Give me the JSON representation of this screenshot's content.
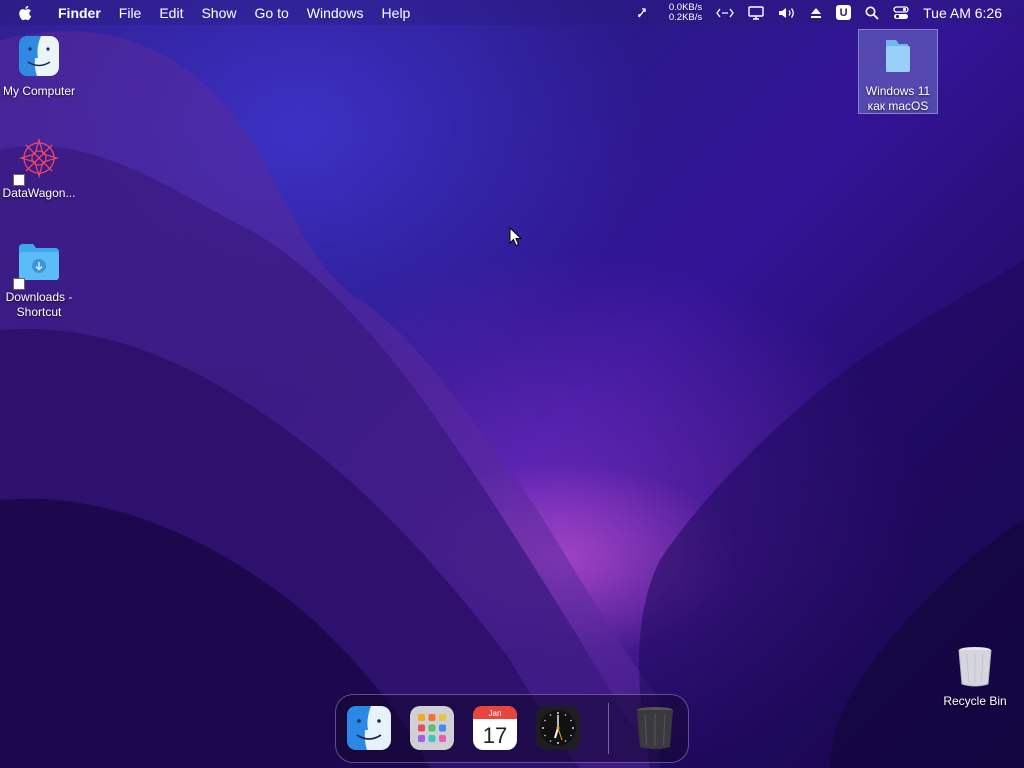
{
  "menubar": {
    "app_name": "Finder",
    "menus": [
      "File",
      "Edit",
      "Show",
      "Go to",
      "Windows",
      "Help"
    ],
    "net_up": "0.0KB/s",
    "net_down": "0.2KB/s",
    "badge_letter": "U",
    "clock": "Tue AM 6:26",
    "icons": [
      "apple-icon",
      "shuffle-arrows-icon",
      "code-arrows-icon",
      "display-icon",
      "volume-icon",
      "eject-icon",
      "search-icon",
      "control-center-icon"
    ]
  },
  "desktop": {
    "icons": [
      {
        "label": "My Computer",
        "icon": "finder-icon"
      },
      {
        "label": "DataWagon...",
        "icon": "datawagon-app-icon",
        "shortcut": true
      },
      {
        "label": "Downloads - Shortcut",
        "icon": "downloads-folder-icon",
        "shortcut": true
      },
      {
        "label": "Windows 11 как macOS",
        "icon": "folder-icon",
        "selected": true
      },
      {
        "label": "Recycle Bin",
        "icon": "recycle-bin-icon"
      }
    ]
  },
  "dock": {
    "items": [
      {
        "name": "Finder",
        "icon": "finder-icon"
      },
      {
        "name": "Launchpad",
        "icon": "launchpad-icon"
      },
      {
        "name": "Calendar",
        "icon": "calendar-icon",
        "month": "Jan",
        "day": "17"
      },
      {
        "name": "Clock",
        "icon": "clock-icon"
      },
      {
        "name": "Trash",
        "icon": "trash-icon"
      }
    ]
  },
  "colors": {
    "accent": "#3fa7f0",
    "calendar_red": "#e8463d"
  }
}
